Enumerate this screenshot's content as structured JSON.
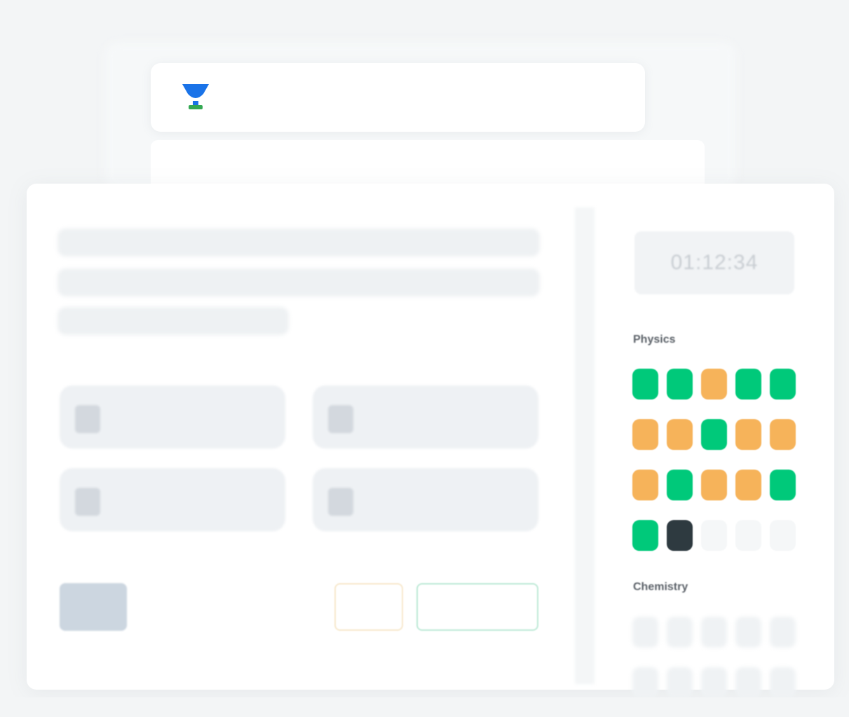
{
  "header": {
    "logo_icon": "trophy-icon",
    "colors": {
      "logo_top": "#1a73e8",
      "logo_base": "#34a853"
    }
  },
  "question_panel": {
    "options": [
      {
        "id": "A"
      },
      {
        "id": "B"
      },
      {
        "id": "C"
      },
      {
        "id": "D"
      }
    ]
  },
  "sidebar": {
    "timer": "01:12:34",
    "sections": [
      {
        "name": "Physics",
        "questions": [
          "answered",
          "answered",
          "not-answered",
          "answered",
          "answered",
          "not-answered",
          "not-answered",
          "answered",
          "not-answered",
          "not-answered",
          "not-answered",
          "answered",
          "not-answered",
          "not-answered",
          "answered",
          "answered",
          "current",
          "not-visited",
          "not-visited",
          "not-visited"
        ]
      },
      {
        "name": "Chemistry",
        "questions": [
          "not-visited",
          "not-visited",
          "not-visited",
          "not-visited",
          "not-visited",
          "not-visited",
          "not-visited",
          "not-visited",
          "not-visited",
          "not-visited"
        ]
      }
    ],
    "colors": {
      "answered": "#00c97a",
      "not_answered": "#f6b35a",
      "current": "#2e3a40",
      "not_visited": "#f5f7f8"
    }
  }
}
